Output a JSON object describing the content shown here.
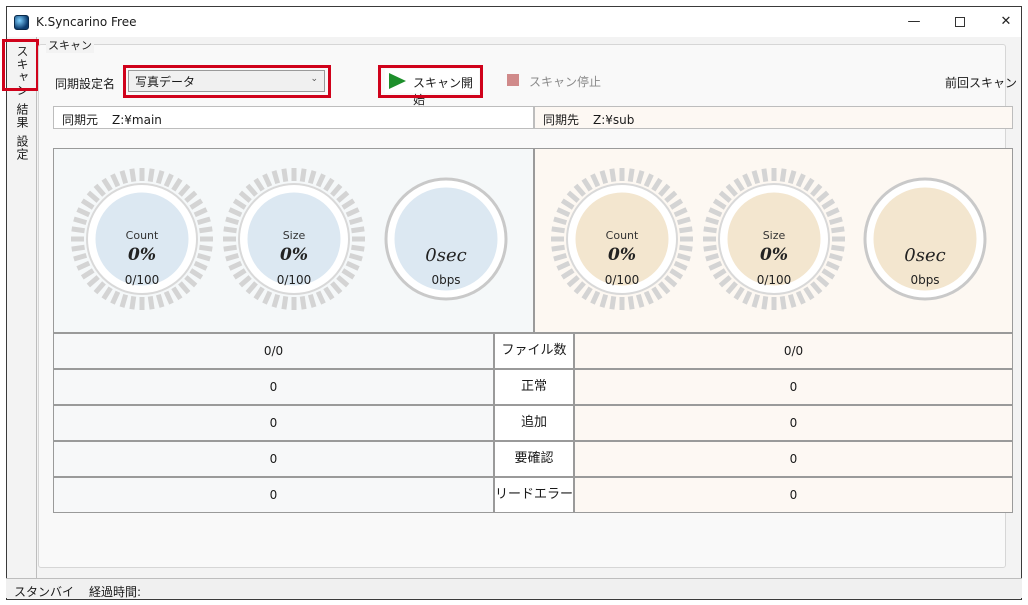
{
  "window": {
    "title": "K.Syncarino Free",
    "minimize": "—",
    "close": "✕"
  },
  "sidebar": {
    "tabs": [
      "スキャン",
      "結果",
      "設定"
    ]
  },
  "scan": {
    "group_label": "スキャン",
    "sync_name_label": "同期設定名",
    "sync_name_value": "写真データ",
    "start_label": "スキャン開始",
    "stop_label": "スキャン停止",
    "prev_label": "前回スキャン"
  },
  "paths": {
    "source_label": "同期元",
    "source_value": "Z:¥main",
    "dest_label": "同期先",
    "dest_value": "Z:¥sub"
  },
  "gauges": {
    "source": {
      "count": {
        "title": "Count",
        "value": "0%",
        "ratio": "0/100",
        "fraction": 0
      },
      "size": {
        "title": "Size",
        "value": "0%",
        "ratio": "0/100",
        "fraction": 0
      },
      "time": {
        "value": "0sec",
        "rate": "0bps"
      }
    },
    "dest": {
      "count": {
        "title": "Count",
        "value": "0%",
        "ratio": "0/100",
        "fraction": 0
      },
      "size": {
        "title": "Size",
        "value": "0%",
        "ratio": "0/100",
        "fraction": 0
      },
      "time": {
        "value": "0sec",
        "rate": "0bps"
      }
    }
  },
  "stats": [
    {
      "label": "ファイル数",
      "source": "0/0",
      "dest": "0/0"
    },
    {
      "label": "正常",
      "source": "0",
      "dest": "0"
    },
    {
      "label": "追加",
      "source": "0",
      "dest": "0"
    },
    {
      "label": "要確認",
      "source": "0",
      "dest": "0"
    },
    {
      "label": "リードエラー",
      "source": "0",
      "dest": "0"
    }
  ],
  "statusbar": {
    "state": "スタンバイ",
    "elapsed_label": "経過時間:"
  },
  "colors": {
    "highlight": "#d0021b",
    "play": "#1d8f2b",
    "gauge_blue": "#dce8f2",
    "gauge_cream": "#f3e6cf"
  }
}
